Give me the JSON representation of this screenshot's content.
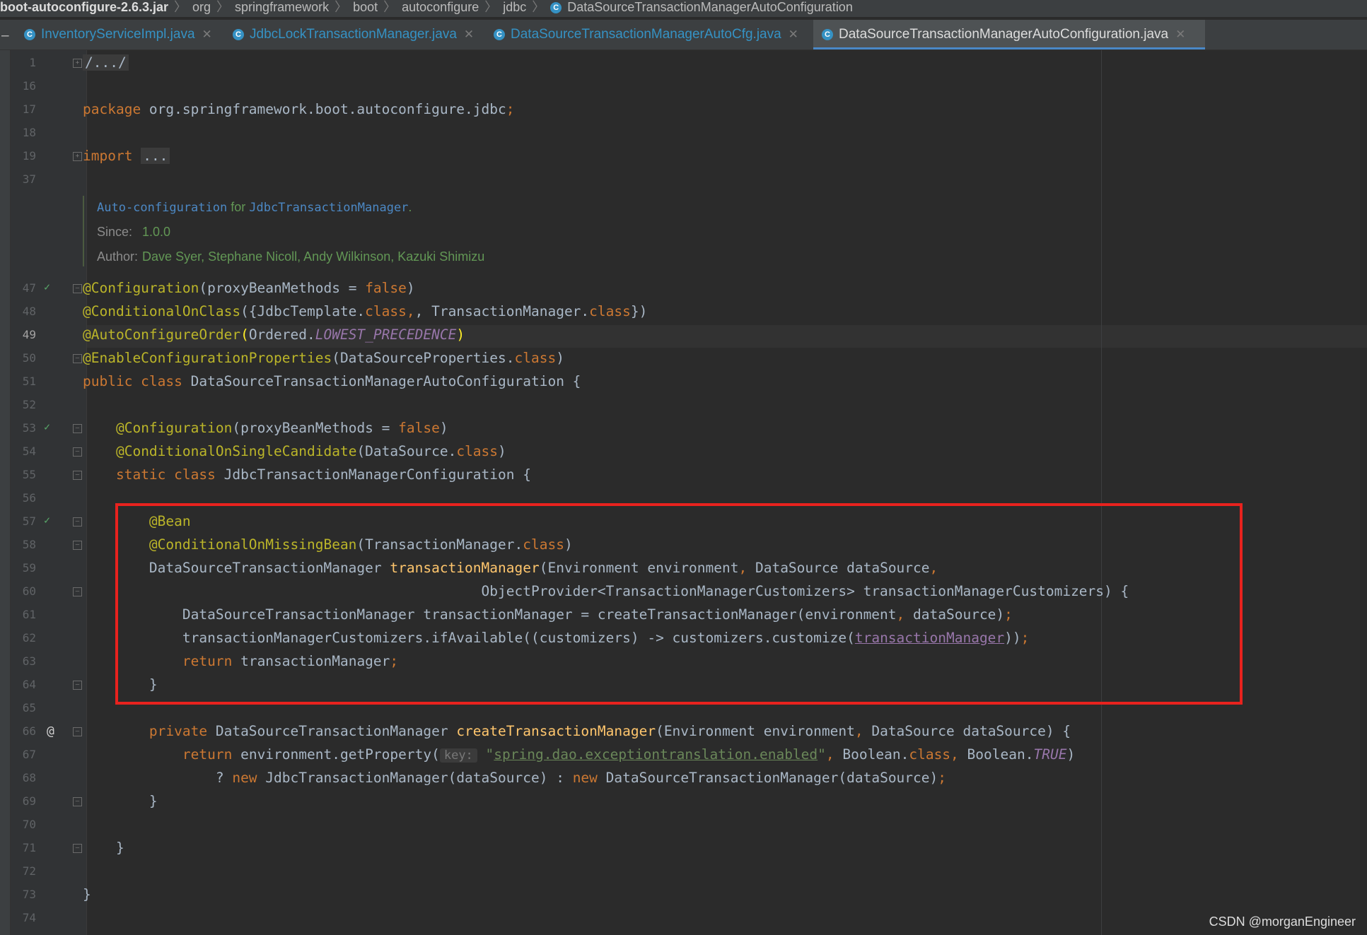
{
  "breadcrumb": {
    "jar": "boot-autoconfigure-2.6.3.jar",
    "parts": [
      "org",
      "springframework",
      "boot",
      "autoconfigure",
      "jdbc"
    ],
    "current": "DataSourceTransactionManagerAutoConfiguration"
  },
  "tabs": [
    {
      "label": "InventoryServiceImpl.java",
      "active": false
    },
    {
      "label": "JdbcLockTransactionManager.java",
      "active": false
    },
    {
      "label": "DataSourceTransactionManagerAutoCfg.java",
      "active": false
    },
    {
      "label": "DataSourceTransactionManagerAutoConfiguration.java",
      "active": true
    }
  ],
  "line_numbers": [
    "1",
    "16",
    "17",
    "18",
    "19",
    "37",
    "47",
    "48",
    "49",
    "50",
    "51",
    "52",
    "53",
    "54",
    "55",
    "56",
    "57",
    "58",
    "59",
    "60",
    "61",
    "62",
    "63",
    "64",
    "65",
    "66",
    "67",
    "68",
    "69",
    "70",
    "71",
    "72",
    "73",
    "74"
  ],
  "current_line": "49",
  "code": {
    "l1_fold": "/.../",
    "l17_kw": "package",
    "l17_rest": " org.springframework.boot.autoconfigure.jdbc",
    "l19_kw": "import",
    "l19_fold": "...",
    "l47_an": "@Configuration",
    "l47_a": "(proxyBeanMethods = ",
    "l47_kw": "false",
    "l47_b": ")",
    "l48_an": "@ConditionalOnClass",
    "l48_a": "({JdbcTemplate.",
    "l48_kw1": "class",
    "l48_b": ", TransactionManager.",
    "l48_kw2": "class",
    "l48_c": "})",
    "l49_an": "@AutoConfigureOrder",
    "l49_p1": "(",
    "l49_a": "Ordered.",
    "l49_cst": "LOWEST_PRECEDENCE",
    "l49_p2": ")",
    "l50_an": "@EnableConfigurationProperties",
    "l50_a": "(DataSourceProperties.",
    "l50_kw": "class",
    "l50_b": ")",
    "l51_kw": "public class",
    "l51_rest": " DataSourceTransactionManagerAutoConfiguration {",
    "l53_an": "@Configuration",
    "l53_a": "(proxyBeanMethods = ",
    "l53_kw": "false",
    "l53_b": ")",
    "l54_an": "@ConditionalOnSingleCandidate",
    "l54_a": "(DataSource.",
    "l54_kw": "class",
    "l54_b": ")",
    "l55_kw": "static class",
    "l55_rest": " JdbcTransactionManagerConfiguration {",
    "l57_an": "@Bean",
    "l58_an": "@ConditionalOnMissingBean",
    "l58_a": "(TransactionManager.",
    "l58_kw": "class",
    "l58_b": ")",
    "l59_a": "DataSourceTransactionManager ",
    "l59_fn": "transactionManager",
    "l59_b": "(Environment environment",
    "l59_c": " DataSource dataSource",
    "l60_a": "ObjectProvider<TransactionManagerCustomizers> transactionManagerCustomizers) {",
    "l61_a": "DataSourceTransactionManager transactionManager = createTransactionManager(environment",
    "l61_b": " dataSource)",
    "l62_a": "transactionManagerCustomizers.ifAvailable((customizers) -> customizers.customize(",
    "l62_ul": "transactionManager",
    "l62_b": "))",
    "l63_kw": "return",
    "l63_a": " transactionManager",
    "brace_close": "}",
    "l66_kw": "private",
    "l66_a": " DataSourceTransactionManager ",
    "l66_fn": "createTransactionManager",
    "l66_b": "(Environment environment",
    "l66_c": " DataSource dataSource) {",
    "l67_kw": "return",
    "l67_a": " environment.getProperty(",
    "l67_hint": "key:",
    "l67_q1": "\"",
    "l67_st": "spring.dao.exceptiontranslation.enabled",
    "l67_q2": "\"",
    "l67_b": " Boolean.",
    "l67_kw2": "class",
    "l67_c": " Boolean.",
    "l67_cst": "TRUE",
    "l67_d": ")",
    "l68_a": "? ",
    "l68_kw1": "new",
    "l68_b": " JdbcTransactionManager(dataSource) : ",
    "l68_kw2": "new",
    "l68_c": " DataSourceTransactionManager(dataSource)",
    "comma": ",",
    "semi": ";"
  },
  "javadoc": {
    "link1": "Auto-configuration",
    "for_text": " for ",
    "link2": "JdbcTransactionManager",
    "period": ".",
    "since_label": "Since:",
    "since_value": "1.0.0",
    "author_label": "Author:",
    "author_value": "Dave Syer, Stephane Nicoll, Andy Wilkinson, Kazuki Shimizu"
  },
  "gutter_icons": {
    "bean_icon": "✓",
    "override_icon": "@"
  },
  "colors": {
    "keyword": "#cc7832",
    "annotation": "#bbb529",
    "method": "#ffc66d",
    "string": "#6a8759",
    "constant": "#9876aa",
    "highlight_box": "#e8221e"
  },
  "watermark": "CSDN @morganEngineer"
}
